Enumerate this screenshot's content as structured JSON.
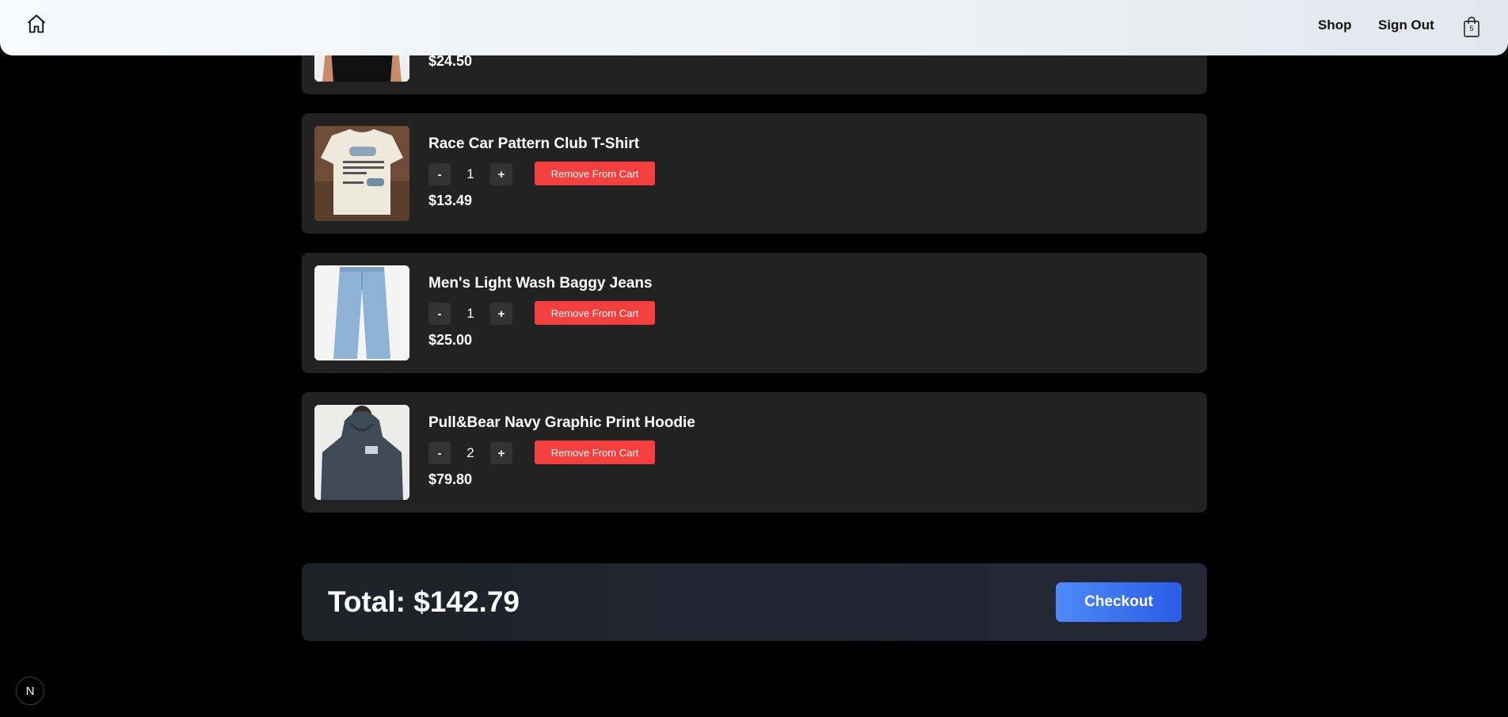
{
  "nav": {
    "home_icon": "home-icon",
    "shop_label": "Shop",
    "signout_label": "Sign Out",
    "cart_icon": "shopping-bag-icon",
    "cart_count": "5"
  },
  "cart": {
    "items": [
      {
        "title": "",
        "quantity": "",
        "remove_label": "",
        "price": "$24.50"
      },
      {
        "title": "Race Car Pattern Club T-Shirt",
        "quantity": "1",
        "remove_label": "Remove From Cart",
        "price": "$13.49"
      },
      {
        "title": "Men's Light Wash Baggy Jeans",
        "quantity": "1",
        "remove_label": "Remove From Cart",
        "price": "$25.00"
      },
      {
        "title": "Pull&Bear Navy Graphic Print Hoodie",
        "quantity": "2",
        "remove_label": "Remove From Cart",
        "price": "$79.80"
      }
    ],
    "minus_label": "-",
    "plus_label": "+"
  },
  "summary": {
    "total_text": "Total: $142.79",
    "checkout_label": "Checkout"
  },
  "dev_badge": {
    "label": "N"
  },
  "colors": {
    "background": "#000000",
    "card": "#222222",
    "remove": "#f43f3f",
    "checkout": "#2b5ce6"
  }
}
